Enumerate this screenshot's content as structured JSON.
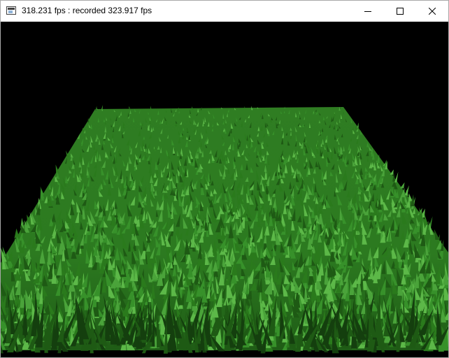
{
  "window": {
    "title": "318.231 fps : recorded 323.917 fps",
    "icon": "app-window-icon",
    "controls": {
      "minimize_icon": "minimize-icon",
      "maximize_icon": "maximize-icon",
      "close_icon": "close-icon"
    }
  },
  "scene": {
    "background_color": "#000000",
    "grass_colors": [
      "#1e5a14",
      "#2a7a1c",
      "#37912a",
      "#4aa33a",
      "#5cb848"
    ]
  }
}
